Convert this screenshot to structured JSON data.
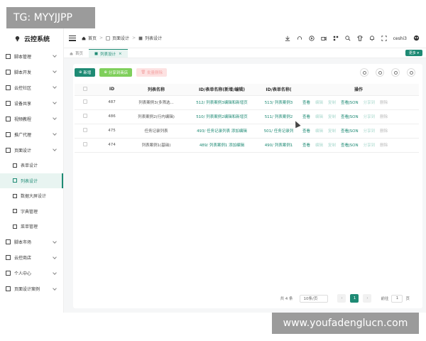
{
  "watermark_top": "TG: MYYJJPP",
  "watermark_bottom": "www.youfadenglucn.com",
  "app": {
    "title": "云控系统",
    "accent": "#1e8a74"
  },
  "sidebar": {
    "items": [
      {
        "label": "脚本管理",
        "icon": "folder-icon"
      },
      {
        "label": "脚本开发",
        "icon": "code-icon"
      },
      {
        "label": "云控社区",
        "icon": "community-icon"
      },
      {
        "label": "设备共享",
        "icon": "device-icon"
      },
      {
        "label": "视频教程",
        "icon": "video-icon"
      },
      {
        "label": "推广代理",
        "icon": "promote-icon"
      },
      {
        "label": "页面设计",
        "icon": "page-design-icon"
      }
    ],
    "subitems": [
      {
        "label": "表单设计",
        "icon": "form-icon"
      },
      {
        "label": "列表设计",
        "icon": "list-icon"
      },
      {
        "label": "数据大屏设计",
        "icon": "dashboard-icon"
      },
      {
        "label": "字典管理",
        "icon": "dictionary-icon"
      },
      {
        "label": "菜单管理",
        "icon": "menu-icon"
      }
    ],
    "items_bottom": [
      {
        "label": "脚本市场",
        "icon": "market-icon"
      },
      {
        "label": "云控商店",
        "icon": "store-icon"
      },
      {
        "label": "个人中心",
        "icon": "user-icon"
      },
      {
        "label": "页面设计案例",
        "icon": "case-icon"
      }
    ]
  },
  "header": {
    "breadcrumb": [
      "首页",
      "页面设计",
      "列表设计"
    ],
    "username": "ceshi3"
  },
  "tabs": [
    {
      "label": "首页"
    },
    {
      "label": "列表设计"
    }
  ],
  "more_label": "更多",
  "toolbar": {
    "add": "新增",
    "share": "分享到商店",
    "delete": "批量删除"
  },
  "table": {
    "columns": [
      "ID",
      "列表名称",
      "ID/表单名称(新增/编辑)",
      "ID/表单名称(",
      "操作"
    ],
    "rows": [
      {
        "id": "487",
        "name": "列表案例3(多筛选...",
        "form_edit": "512/ 列表案例3编辑和新增页",
        "form_view": "513/ 列表案例3"
      },
      {
        "id": "486",
        "name": "列表案例2(行内编辑)",
        "form_edit": "510/ 列表案例2编辑和新增页",
        "form_view": "511/ 列表案例2"
      },
      {
        "id": "475",
        "name": "任务记录列表",
        "form_edit": "493/ 任务记录列表 添加编辑",
        "form_view": "501/ 任务记录列"
      },
      {
        "id": "474",
        "name": "列表案例1(基础)",
        "form_edit": "489/ 列表案例1 添加编辑",
        "form_view": "490/ 列表案例1"
      }
    ],
    "actions": {
      "view": "查看",
      "edit": "编辑",
      "copy": "复制",
      "json": "查看JSON",
      "share": "分享到",
      "delete": "删除"
    }
  },
  "pagination": {
    "total": "共 4 条",
    "page_size": "10条/页",
    "current": "1",
    "goto_label": "前往",
    "goto_value": "1",
    "page_unit": "页"
  }
}
